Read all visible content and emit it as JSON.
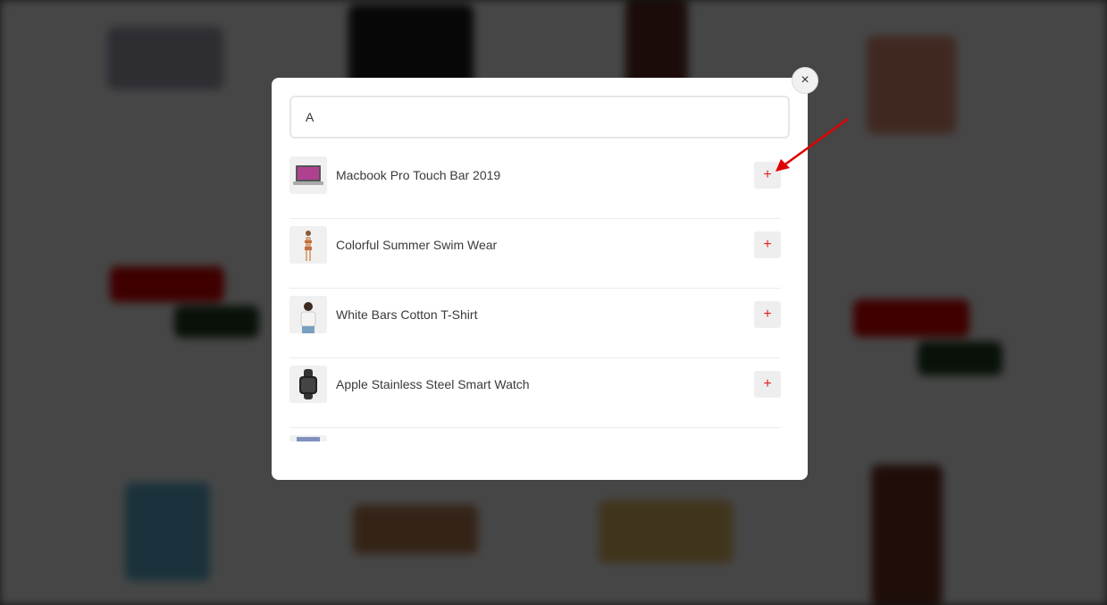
{
  "search": {
    "value": "A"
  },
  "close_icon": "×",
  "products": [
    {
      "name": "Macbook Pro Touch Bar 2019",
      "add_label": "+"
    },
    {
      "name": "Colorful Summer Swim Wear",
      "add_label": "+"
    },
    {
      "name": "White Bars Cotton T-Shirt",
      "add_label": "+"
    },
    {
      "name": "Apple Stainless Steel Smart Watch",
      "add_label": "+"
    }
  ],
  "colors": {
    "accent": "#e02020",
    "arrow": "#e00000",
    "overlay": "rgba(0,0,0,0.7)"
  }
}
